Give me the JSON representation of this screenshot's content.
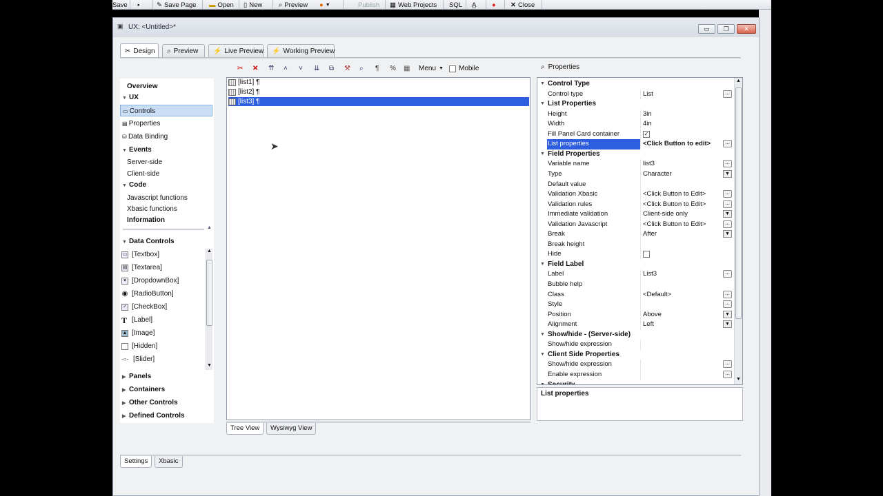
{
  "toolbar": {
    "save": "Save",
    "save_page": "Save Page",
    "open": "Open",
    "new": "New",
    "preview": "Preview",
    "publish": "Publish",
    "web_projects": "Web Projects",
    "sql": "SQL",
    "close": "Close"
  },
  "window": {
    "title": "UX: <Untitled>*"
  },
  "tabs": [
    "Design",
    "Preview",
    "Live Preview",
    "Working Preview"
  ],
  "left_nav": {
    "overview": "Overview",
    "ux": "UX",
    "controls": "Controls",
    "properties": "Properties",
    "data_binding": "Data Binding",
    "events": "Events",
    "server_side": "Server-side",
    "client_side": "Client-side",
    "code": "Code",
    "javascript_functions": "Javascript functions",
    "xbasic_functions": "Xbasic functions",
    "information": "Information",
    "data_controls": "Data Controls",
    "controls_list": [
      "[Textbox]",
      "[Textarea]",
      "[DropdownBox]",
      "[RadioButton]",
      "[CheckBox]",
      "[Label]",
      "[Image]",
      "[Hidden]",
      "[Slider]"
    ],
    "panels": "Panels",
    "containers": "Containers",
    "other_controls": "Other Controls",
    "defined_controls": "Defined Controls"
  },
  "canvas_toolbar": {
    "menu": "Menu",
    "mobile": "Mobile"
  },
  "tree_items": [
    "[list1] ¶",
    "[list2] ¶",
    "[list3] ¶"
  ],
  "view_tabs": [
    "Tree View",
    "Wysiwyg View"
  ],
  "properties": {
    "header": "Properties",
    "rows": [
      {
        "cat": true,
        "name": "Control Type"
      },
      {
        "name": "Control type",
        "value": "List",
        "btn": "dots"
      },
      {
        "cat": true,
        "name": "List Properties"
      },
      {
        "name": "Height",
        "value": "3in"
      },
      {
        "name": "Width",
        "value": "4in"
      },
      {
        "name": "Fill Panel Card container",
        "check": true,
        "checked": true
      },
      {
        "name": "List properties",
        "value": "<Click Button to edit>",
        "btn": "dots",
        "hl": true,
        "bold": true
      },
      {
        "cat": true,
        "name": "Field Properties"
      },
      {
        "name": "Variable name",
        "value": "list3",
        "btn": "dots"
      },
      {
        "name": "Type",
        "value": "Character",
        "btn": "dd"
      },
      {
        "name": "Default value",
        "value": ""
      },
      {
        "name": "Validation Xbasic",
        "value": "<Click Button to Edit>",
        "btn": "dots"
      },
      {
        "name": "Validation rules",
        "value": "<Click Button to Edit>",
        "btn": "dots"
      },
      {
        "name": "Immediate validation",
        "value": "Client-side only",
        "btn": "dd"
      },
      {
        "name": "Validation Javascript",
        "value": "<Click Button to Edit>",
        "btn": "dots"
      },
      {
        "name": "Break",
        "value": "After",
        "btn": "dd"
      },
      {
        "name": "Break height",
        "value": ""
      },
      {
        "name": "Hide",
        "check": true,
        "checked": false
      },
      {
        "cat": true,
        "name": "Field Label"
      },
      {
        "name": "Label",
        "value": "List3",
        "btn": "dots"
      },
      {
        "name": "Bubble help",
        "value": ""
      },
      {
        "name": "Class",
        "value": "<Default>",
        "btn": "dots"
      },
      {
        "name": "Style",
        "value": "",
        "btn": "dots"
      },
      {
        "name": "Position",
        "value": "Above",
        "btn": "dd"
      },
      {
        "name": "Alignment",
        "value": "Left",
        "btn": "dd"
      },
      {
        "cat": true,
        "name": "Show/hide - (Server-side)"
      },
      {
        "name": "Show/hide expression",
        "value": ""
      },
      {
        "cat": true,
        "name": "Client Side Properties"
      },
      {
        "name": "Show/hide expression",
        "value": "",
        "btn": "dots"
      },
      {
        "name": "Enable expression",
        "value": "",
        "btn": "dots"
      },
      {
        "cat": true,
        "name": "Security"
      }
    ],
    "description": "List properties"
  },
  "bottom_tabs": [
    "Settings",
    "Xbasic"
  ]
}
